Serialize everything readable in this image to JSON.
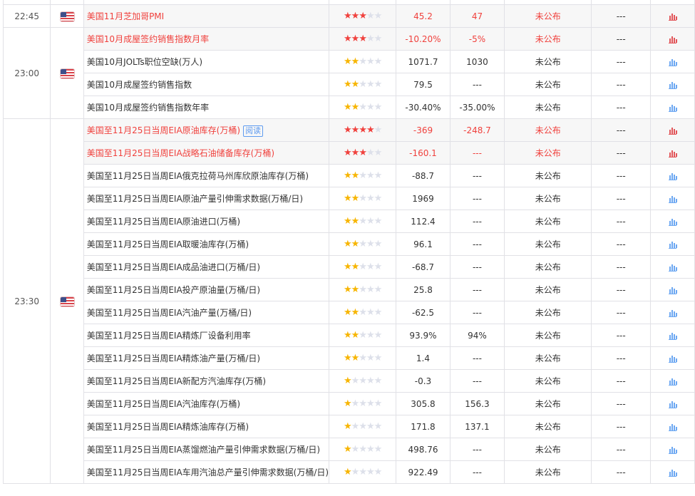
{
  "colors": {
    "important": "#f0413d",
    "star_gold": "#f7b500",
    "chart_blue": "#6da8f2"
  },
  "groups": [
    {
      "time": "22:45",
      "flag": "us-flag-icon",
      "rows": [
        {
          "name": "美国11月芝加哥PMI",
          "stars": 3,
          "important": true,
          "previous": "45.2",
          "forecast": "47",
          "actual": "未公布",
          "impact": "---"
        }
      ]
    },
    {
      "time": "23:00",
      "flag": "us-flag-icon",
      "rows": [
        {
          "name": "美国10月成屋签约销售指数月率",
          "stars": 3,
          "important": true,
          "previous": "-10.20%",
          "forecast": "-5%",
          "actual": "未公布",
          "impact": "---"
        },
        {
          "name": "美国10月JOLTs职位空缺(万人)",
          "stars": 2,
          "important": false,
          "previous": "1071.7",
          "forecast": "1030",
          "actual": "未公布",
          "impact": "---"
        },
        {
          "name": "美国10月成屋签约销售指数",
          "stars": 2,
          "important": false,
          "previous": "79.5",
          "forecast": "---",
          "actual": "未公布",
          "impact": "---"
        },
        {
          "name": "美国10月成屋签约销售指数年率",
          "stars": 2,
          "important": false,
          "previous": "-30.40%",
          "forecast": "-35.00%",
          "actual": "未公布",
          "impact": "---"
        }
      ]
    },
    {
      "time": "23:30",
      "flag": "us-flag-icon",
      "rows": [
        {
          "name": "美国至11月25日当周EIA原油库存(万桶)",
          "tag": "阅读",
          "stars": 4,
          "important": true,
          "previous": "-369",
          "forecast": "-248.7",
          "actual": "未公布",
          "impact": "---"
        },
        {
          "name": "美国至11月25日当周EIA战略石油储备库存(万桶)",
          "stars": 3,
          "important": true,
          "previous": "-160.1",
          "forecast": "---",
          "actual": "未公布",
          "impact": "---"
        },
        {
          "name": "美国至11月25日当周EIA俄克拉荷马州库欣原油库存(万桶)",
          "stars": 2,
          "important": false,
          "previous": "-88.7",
          "forecast": "---",
          "actual": "未公布",
          "impact": "---"
        },
        {
          "name": "美国至11月25日当周EIA原油产量引伸需求数据(万桶/日)",
          "stars": 2,
          "important": false,
          "previous": "1969",
          "forecast": "---",
          "actual": "未公布",
          "impact": "---"
        },
        {
          "name": "美国至11月25日当周EIA原油进口(万桶)",
          "stars": 2,
          "important": false,
          "previous": "112.4",
          "forecast": "---",
          "actual": "未公布",
          "impact": "---"
        },
        {
          "name": "美国至11月25日当周EIA取暖油库存(万桶)",
          "stars": 2,
          "important": false,
          "previous": "96.1",
          "forecast": "---",
          "actual": "未公布",
          "impact": "---"
        },
        {
          "name": "美国至11月25日当周EIA成品油进口(万桶/日)",
          "stars": 2,
          "important": false,
          "previous": "-68.7",
          "forecast": "---",
          "actual": "未公布",
          "impact": "---"
        },
        {
          "name": "美国至11月25日当周EIA投产原油量(万桶/日)",
          "stars": 2,
          "important": false,
          "previous": "25.8",
          "forecast": "---",
          "actual": "未公布",
          "impact": "---"
        },
        {
          "name": "美国至11月25日当周EIA汽油产量(万桶/日)",
          "stars": 2,
          "important": false,
          "previous": "-62.5",
          "forecast": "---",
          "actual": "未公布",
          "impact": "---"
        },
        {
          "name": "美国至11月25日当周EIA精炼厂设备利用率",
          "stars": 2,
          "important": false,
          "previous": "93.9%",
          "forecast": "94%",
          "actual": "未公布",
          "impact": "---"
        },
        {
          "name": "美国至11月25日当周EIA精炼油产量(万桶/日)",
          "stars": 2,
          "important": false,
          "previous": "1.4",
          "forecast": "---",
          "actual": "未公布",
          "impact": "---"
        },
        {
          "name": "美国至11月25日当周EIA新配方汽油库存(万桶)",
          "stars": 1,
          "important": false,
          "previous": "-0.3",
          "forecast": "---",
          "actual": "未公布",
          "impact": "---"
        },
        {
          "name": "美国至11月25日当周EIA汽油库存(万桶)",
          "stars": 1,
          "important": false,
          "previous": "305.8",
          "forecast": "156.3",
          "actual": "未公布",
          "impact": "---"
        },
        {
          "name": "美国至11月25日当周EIA精炼油库存(万桶)",
          "stars": 1,
          "important": false,
          "previous": "171.8",
          "forecast": "137.1",
          "actual": "未公布",
          "impact": "---"
        },
        {
          "name": "美国至11月25日当周EIA蒸馏燃油产量引伸需求数据(万桶/日)",
          "stars": 1,
          "important": false,
          "previous": "498.76",
          "forecast": "---",
          "actual": "未公布",
          "impact": "---"
        },
        {
          "name": "美国至11月25日当周EIA车用汽油总产量引伸需求数据(万桶/日)",
          "stars": 1,
          "important": false,
          "previous": "922.49",
          "forecast": "---",
          "actual": "未公布",
          "impact": "---"
        }
      ]
    }
  ]
}
